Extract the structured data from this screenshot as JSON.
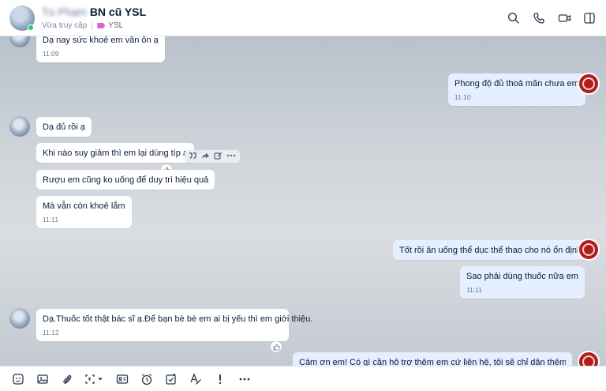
{
  "header": {
    "name_blurred": "Tú Phạm",
    "name": "BN cũ YSL",
    "status": "Vừa truy cập",
    "tag_label": "YSL"
  },
  "messages": [
    {
      "text": "Dạ nay sức khoẻ em vẫn ổn ạ",
      "time": "11:09"
    },
    {
      "text": "Phong độ đủ thoả mãn chưa em",
      "time": "11:10"
    },
    {
      "text": "Dạ đủ rồi ạ"
    },
    {
      "text": "Khi nào suy giảm thì em lại dùng típ ạ"
    },
    {
      "text": "Rượu em cũng ko uống để duy trì hiệu quả"
    },
    {
      "text": "Mà vẫn còn khoẻ lắm",
      "time": "11:11"
    },
    {
      "text": "Tốt rồi ăn uống thể dục thể thao cho nó ổn định"
    },
    {
      "text": "Sao phải dùng thuốc nữa em",
      "time": "11:11"
    },
    {
      "text": "Dạ.Thuốc tốt thật bác sĩ ạ.Để bạn bè bè em ai bị yếu thì em giới thiệu.",
      "time": "11:12"
    },
    {
      "text": "Cảm ơn em! Có gì cần hỗ trợ thêm em cứ liên hệ, tôi sẽ chỉ dẫn thêm cho em"
    }
  ],
  "icons": {
    "header": [
      "search-icon",
      "phone-icon",
      "video-call-icon",
      "sidebar-toggle-icon"
    ],
    "message_actions": [
      "quote-icon",
      "forward-icon",
      "edit-icon",
      "more-icon"
    ],
    "toolbar": [
      "sticker-icon",
      "image-icon",
      "attachment-icon",
      "screenshot-icon",
      "contact-card-icon",
      "reminder-icon",
      "todo-icon",
      "text-format-icon",
      "urgent-icon",
      "more-icon"
    ]
  },
  "colors": {
    "my_bubble": "#e5efff",
    "their_bubble": "#ffffff",
    "tag": "#e05fd1",
    "online": "#2ec27e"
  }
}
